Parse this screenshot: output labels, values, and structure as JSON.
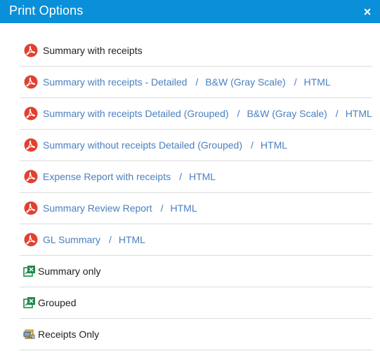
{
  "dialog": {
    "title": "Print Options",
    "close_label": "×"
  },
  "options": [
    {
      "label": "Summary with receipts",
      "icon": "pdf-icon",
      "links": []
    },
    {
      "label": "Summary with receipts - Detailed",
      "icon": "pdf-icon",
      "links": [
        "B&W (Gray Scale)",
        "HTML"
      ]
    },
    {
      "label": "Summary with receipts Detailed (Grouped)",
      "icon": "pdf-icon",
      "links": [
        "B&W (Gray Scale)",
        "HTML"
      ]
    },
    {
      "label": "Summary without receipts Detailed (Grouped)",
      "icon": "pdf-icon",
      "links": [
        "HTML"
      ]
    },
    {
      "label": "Expense Report with receipts",
      "icon": "pdf-icon",
      "links": [
        "HTML"
      ]
    },
    {
      "label": "Summary Review Report",
      "icon": "pdf-icon",
      "links": [
        "HTML"
      ]
    },
    {
      "label": "GL Summary",
      "icon": "pdf-icon",
      "links": [
        "HTML"
      ]
    },
    {
      "label": "Summary only",
      "icon": "excel-export-icon",
      "links": []
    },
    {
      "label": "Grouped",
      "icon": "excel-export-icon",
      "links": []
    },
    {
      "label": "Receipts Only",
      "icon": "receipts-icon",
      "links": []
    }
  ],
  "separator": "/",
  "colors": {
    "header_bg": "#0a8fd9",
    "link": "#4a7fbf",
    "pdf_red": "#e2412f",
    "excel_green": "#1f8a4c"
  }
}
